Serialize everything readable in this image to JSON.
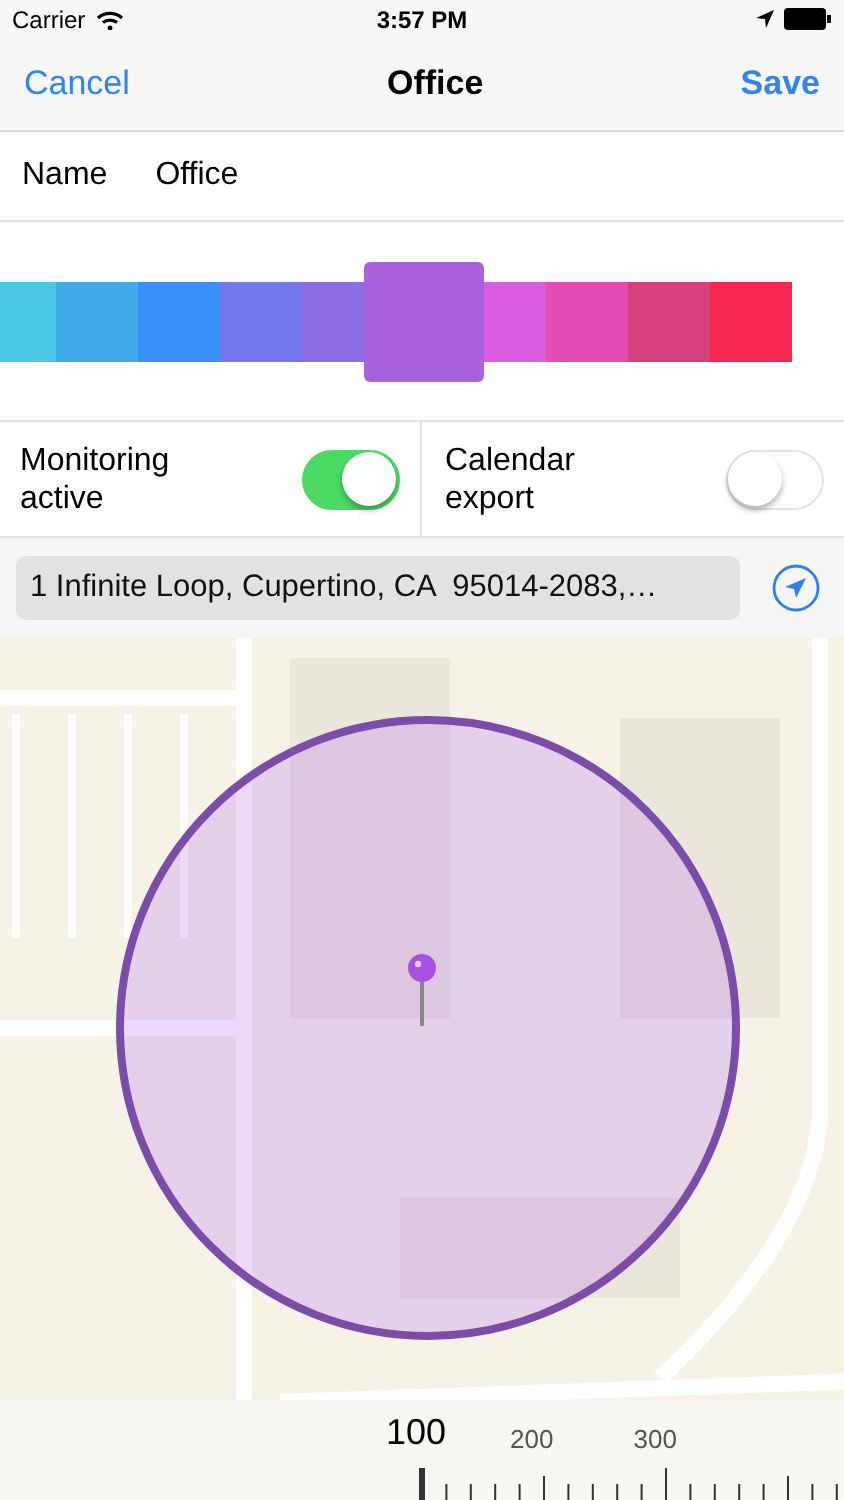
{
  "status_bar": {
    "carrier": "Carrier",
    "time": "3:57 PM"
  },
  "nav": {
    "cancel": "Cancel",
    "title": "Office",
    "save": "Save"
  },
  "name_row": {
    "label": "Name",
    "value": "Office"
  },
  "swatches": [
    {
      "color": "#4ac8e6",
      "selected": false
    },
    {
      "color": "#3eabea",
      "selected": false
    },
    {
      "color": "#3a90f6",
      "selected": false
    },
    {
      "color": "#7577ef",
      "selected": false
    },
    {
      "color": "#8c6de6",
      "selected": false
    },
    {
      "color": "#a962de",
      "selected": true
    },
    {
      "color": "#d95ce1",
      "selected": false
    },
    {
      "color": "#e34cb2",
      "selected": false
    },
    {
      "color": "#d6417d",
      "selected": false
    },
    {
      "color": "#f72650",
      "selected": false
    }
  ],
  "toggles": [
    {
      "label": "Monitoring active",
      "on": true
    },
    {
      "label": "Calendar export",
      "on": false
    }
  ],
  "address": {
    "value": "1 Infinite Loop, Cupertino, CA  95014-2083,…"
  },
  "ruler": {
    "marks": [
      {
        "label": "100",
        "selected": true
      },
      {
        "label": "200",
        "selected": false
      },
      {
        "label": "300",
        "selected": false
      }
    ]
  }
}
